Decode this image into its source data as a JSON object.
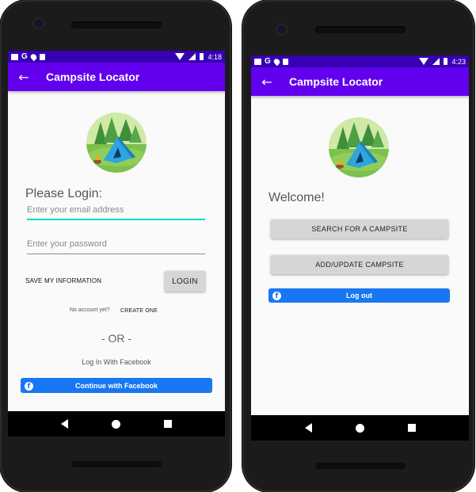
{
  "app": {
    "title": "Campsite Locator",
    "accent_color": "#6200ee",
    "status_color": "#3700b3",
    "facebook_color": "#1877f2"
  },
  "left_phone": {
    "status_time": "4:18",
    "status_icons": [
      "image-icon",
      "google-g-icon",
      "location-pin-icon",
      "sd-card-icon",
      "wifi-icon",
      "signal-icon",
      "battery-icon"
    ],
    "heading": "Please Login:",
    "email_placeholder": "Enter your email address",
    "password_placeholder": "Enter your password",
    "save_info_label": "SAVE MY INFORMATION",
    "login_label": "LOGIN",
    "no_account_text": "No account yet?",
    "create_one_label": "CREATE ONE",
    "or_divider": "- OR -",
    "facebook_caption": "Log In With Facebook",
    "facebook_button_label": "Continue with Facebook"
  },
  "right_phone": {
    "status_time": "4:23",
    "status_icons": [
      "image-icon",
      "google-g-icon",
      "location-pin-icon",
      "sd-card-icon",
      "wifi-icon",
      "signal-icon",
      "battery-icon"
    ],
    "heading": "Welcome!",
    "search_button_label": "SEARCH FOR A CAMPSITE",
    "add_update_button_label": "ADD/UPDATE CAMPSITE",
    "logout_button_label": "Log out"
  },
  "icons": {
    "back": "back-arrow-icon",
    "nav": [
      "nav-back-icon",
      "nav-home-icon",
      "nav-recents-icon"
    ],
    "facebook": "facebook-icon",
    "logo": "campsite-tent-logo"
  }
}
